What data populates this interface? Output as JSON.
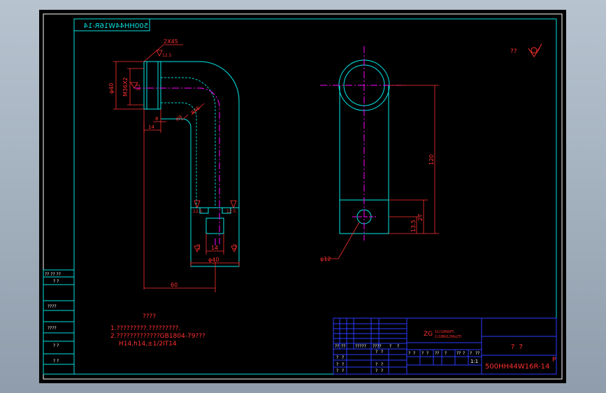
{
  "drawing": {
    "colors": {
      "frame": "#ffffff",
      "border": "#00e0e0",
      "outline": "#00e8e8",
      "centerline": "#ff00ff",
      "dimension": "#ff3030",
      "table": "#2a3cff",
      "table_text": "#ffffff",
      "title_text": "#ff3030"
    },
    "mirrored_code": "500HH44W16R-14",
    "roughness_note": "??",
    "left_strip": {
      "labels": [
        "? ?",
        "????",
        "????",
        "? ?",
        "? ?"
      ],
      "top_label": "?? ?? ??"
    },
    "dims": {
      "chamfer": "2X45",
      "dia40_top": "φ40",
      "m36": "M36X2",
      "rough_top": "12.5",
      "rough_top2": "3.2",
      "d14": "14",
      "d8": "8",
      "r46": "R46",
      "r9": "R9",
      "rough_l": "12.5",
      "rough_r": "12.5",
      "rough_bl": "3.2",
      "rough_br": "3.2",
      "w14": "14",
      "dia40_bot": "φ40",
      "len60": "60",
      "h120": "120",
      "h27": "27",
      "h13_5": "13.5",
      "dia12": "φ12"
    },
    "notes": {
      "title": "????",
      "line1": "1.?????????.?????????.",
      "line2": "2.?????????????GB1804-79???",
      "line3": "H14,h14,±1/2IT14"
    },
    "title_block": {
      "material_main": "ZG",
      "material_sub1": "1Cr18Ni9Ti",
      "material_sub2": "Cr18Ni12Mo2Ti",
      "head_cells": [
        "??",
        "??",
        "?????",
        "????",
        "?",
        "?"
      ],
      "rows_left": [
        [
          "?",
          "?"
        ],
        [
          "?",
          "?"
        ],
        [
          "?",
          "?"
        ]
      ],
      "rows_mid": [
        [
          "?",
          "?"
        ],
        [
          "?",
          "?"
        ],
        [
          "?",
          "?"
        ]
      ],
      "scale_heads": [
        "?",
        "?",
        "?",
        "?",
        "??",
        "?",
        "??",
        "?",
        "?",
        "??"
      ],
      "scale": "1:1",
      "company": "?  ?",
      "part_no": "500HH44W16R-14",
      "sheet_mark": "P"
    }
  }
}
